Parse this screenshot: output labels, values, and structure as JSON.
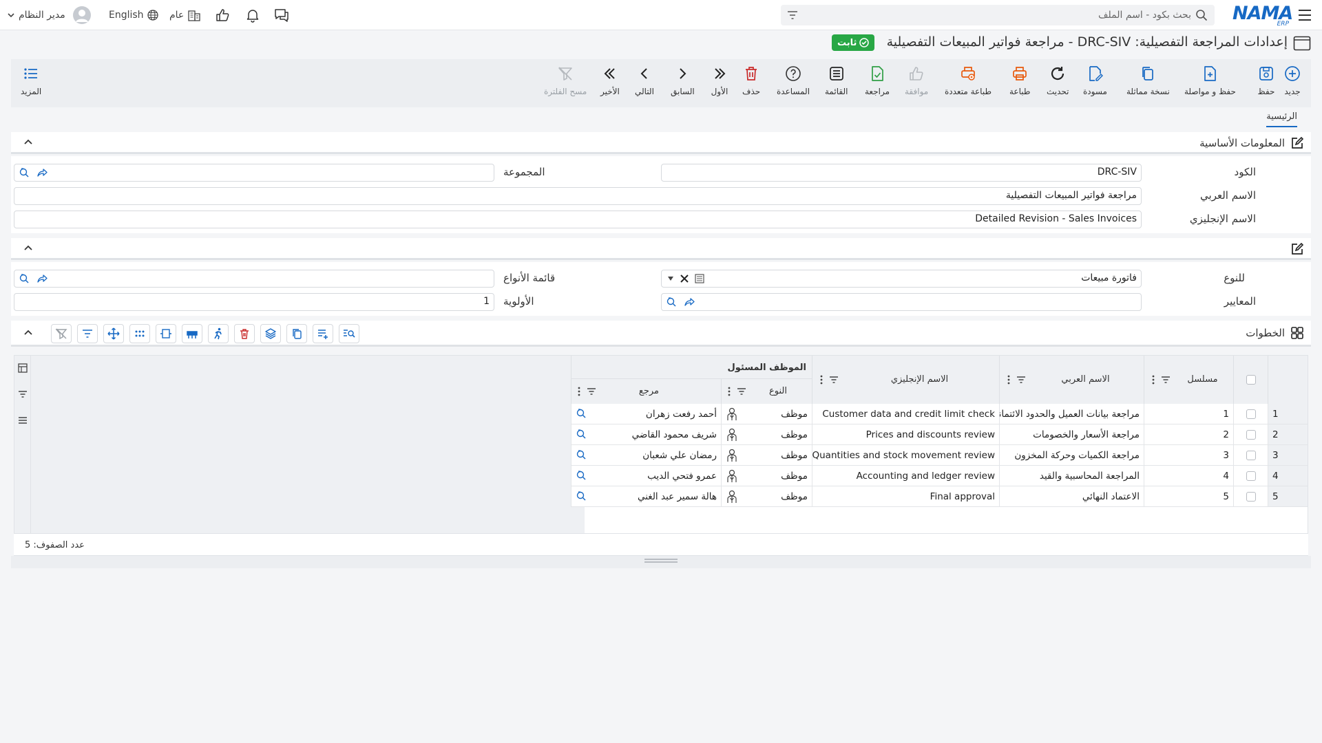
{
  "topbar": {
    "logo": "NAMA",
    "logo_sub": "ERP",
    "search_placeholder": "بحث بكود - اسم الملف",
    "language": "English",
    "scope": "عام",
    "user": "مدير النظام"
  },
  "header": {
    "title": "إعدادات المراجعة التفصيلية: DRC-SIV - مراجعة فواتير المبيعات التفصيلية",
    "status": "ثابت"
  },
  "toolbar": {
    "new": "جديد",
    "save": "حفظ",
    "save_continue": "حفظ و مواصلة",
    "duplicate": "نسخة مماثلة",
    "draft": "مسودة",
    "refresh": "تحديث",
    "print": "طباعة",
    "multi_print": "طباعة متعددة",
    "approve": "موافقة",
    "review": "مراجعة",
    "list": "القائمة",
    "help": "المساعدة",
    "delete": "حذف",
    "first": "الأول",
    "previous": "السابق",
    "next": "التالي",
    "last": "الأخير",
    "clear_filter": "مسح الفلترة",
    "more": "المزيد"
  },
  "tabs": {
    "main": "الرئيسية"
  },
  "basic": {
    "section_title": "المعلومات الأساسية",
    "code_label": "الكود",
    "code_value": "DRC-SIV",
    "group_label": "المجموعة",
    "arabic_name_label": "الاسم العربي",
    "arabic_name_value": "مراجعة فواتير المبيعات التفصيلية",
    "english_name_label": "الاسم الإنجليزي",
    "english_name_value": "Detailed Revision - Sales Invoices"
  },
  "settings": {
    "for_type_label": "للنوع",
    "for_type_value": "فاتورة مبيعات",
    "types_list_label": "قائمة الأنواع",
    "criteria_label": "المعايير",
    "priority_label": "الأولوية",
    "priority_value": "1"
  },
  "steps": {
    "section_title": "الخطوات",
    "columns": {
      "serial": "مسلسل",
      "arabic_name": "الاسم العربي",
      "english_name": "الاسم الإنجليزي",
      "responsible_group": "الموظف المسئول",
      "type": "النوع",
      "reference": "مرجع"
    },
    "rows": [
      {
        "num": "1",
        "serial": "1",
        "arabic": "مراجعة بيانات العميل والحدود الائتمانية",
        "english": "Customer data and credit limit check",
        "type": "موظف",
        "ref": "أحمد رفعت زهران"
      },
      {
        "num": "2",
        "serial": "2",
        "arabic": "مراجعة الأسعار والخصومات",
        "english": "Prices and discounts review",
        "type": "موظف",
        "ref": "شريف محمود القاضي"
      },
      {
        "num": "3",
        "serial": "3",
        "arabic": "مراجعة الكميات وحركة المخزون",
        "english": "Quantities and stock movement review",
        "type": "موظف",
        "ref": "رمضان علي شعبان"
      },
      {
        "num": "4",
        "serial": "4",
        "arabic": "المراجعة المحاسبية والقيد",
        "english": "Accounting and ledger review",
        "type": "موظف",
        "ref": "عمرو فتحي الديب"
      },
      {
        "num": "5",
        "serial": "5",
        "arabic": "الاعتماد النهائي",
        "english": "Final approval",
        "type": "موظف",
        "ref": "هالة سمير عبد الغني"
      }
    ],
    "footer": "عدد الصفوف: 5"
  }
}
